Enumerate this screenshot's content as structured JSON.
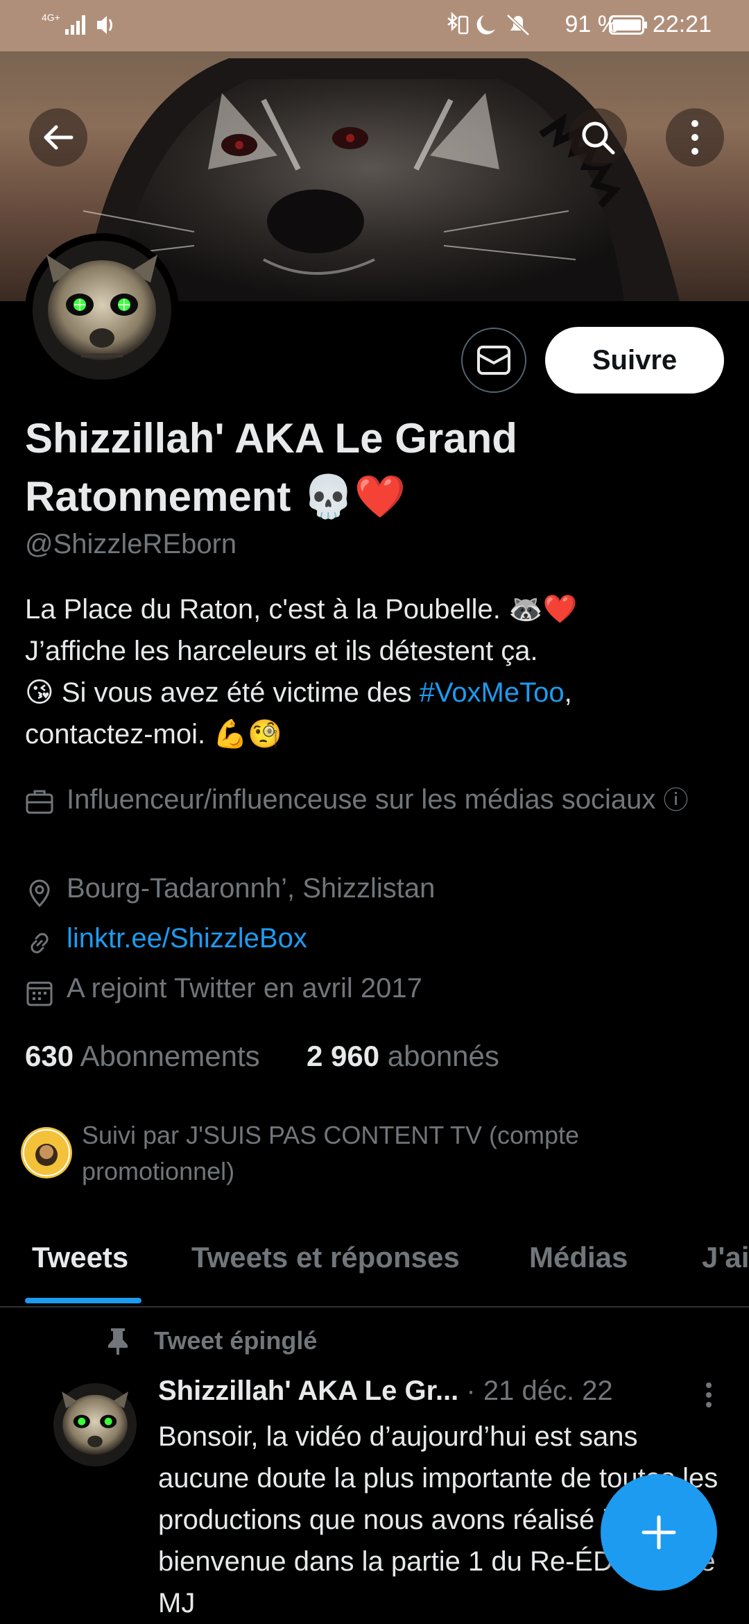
{
  "status_bar": {
    "network": "4G+",
    "battery_percent": "91 %",
    "time": "22:21"
  },
  "profile": {
    "display_name": "Shizzillah' AKA Le Grand Ratonnement 💀❤️",
    "handle": "@ShizzleREborn",
    "bio_line1": "La Place du Raton, c'est à la Poubelle. 🦝❤️",
    "bio_line2": "J’affiche les harceleurs et ils détestent ça.",
    "bio_line3_before": "😘  Si vous avez été victime des ",
    "bio_hashtag": "#VoxMeToo",
    "bio_line3_after": ",",
    "bio_line4": "contactez-moi. 💪🧐",
    "category": "Influenceur/influenceuse sur les médias sociaux",
    "category_info": "ⓘ",
    "location": "Bourg-Tadaronnh’, Shizzlistan",
    "link": "linktr.ee/ShizzleBox",
    "joined": "A rejoint Twitter en avril 2017",
    "following_count": "630",
    "following_label": "Abonnements",
    "followers_count": "2 960",
    "followers_label": "abonnés",
    "followed_by": "Suivi par J'SUIS PAS CONTENT TV (compte promotionnel)"
  },
  "actions": {
    "follow_label": "Suivre"
  },
  "tabs": [
    {
      "label": "Tweets"
    },
    {
      "label": "Tweets et réponses"
    },
    {
      "label": "Médias"
    },
    {
      "label": "J'ai"
    }
  ],
  "tweet": {
    "pinned_label": "Tweet épinglé",
    "author": "Shizzillah' AKA Le Gr...",
    "date": "· 21 déc. 22",
    "body": "Bonsoir, la vidéo d’aujourd’hui est sans aucune doute la plus importante de toutes les productions que nous avons réalisé jusqu’ici, bienvenue dans la partie 1 du Re-ÉDUKH’ de MJ"
  },
  "colors": {
    "accent": "#1d9bf0",
    "background": "#000000",
    "muted_text": "#71767b"
  }
}
